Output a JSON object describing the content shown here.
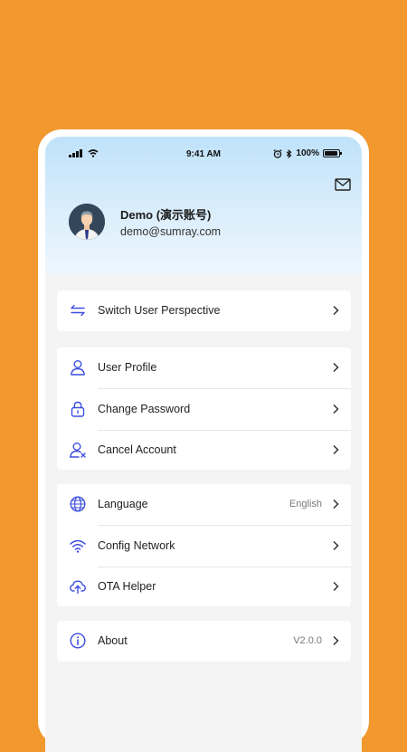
{
  "status_bar": {
    "time": "9:41 AM",
    "battery": "100%"
  },
  "header": {
    "user_name": "Demo (演示账号)",
    "user_email": "demo@sumray.com"
  },
  "menu": {
    "switch": {
      "label": "Switch User Perspective"
    },
    "account": [
      {
        "label": "User Profile"
      },
      {
        "label": "Change Password"
      },
      {
        "label": "Cancel Account"
      }
    ],
    "settings": [
      {
        "label": "Language",
        "value": "English"
      },
      {
        "label": "Config Network"
      },
      {
        "label": "OTA Helper"
      }
    ],
    "about": {
      "label": "About",
      "value": "V2.0.0"
    }
  },
  "colors": {
    "accent": "#3D4FE0",
    "background": "#F1982E"
  }
}
